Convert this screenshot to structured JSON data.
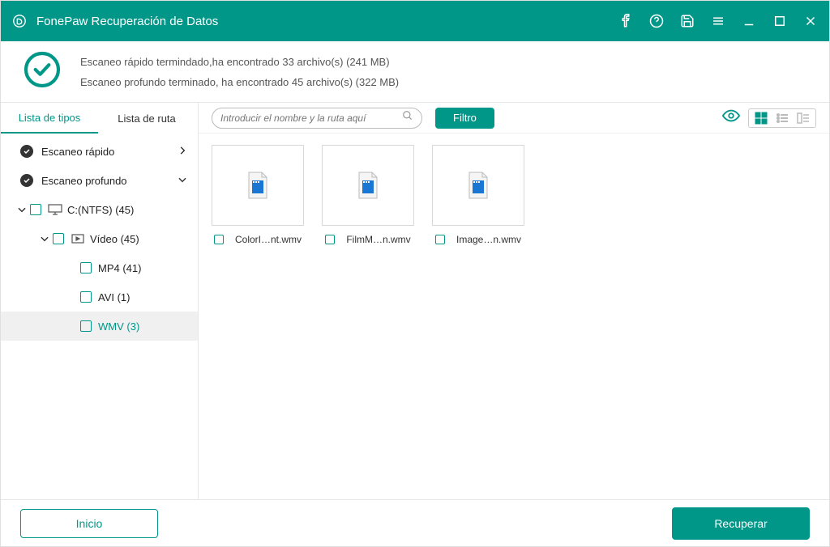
{
  "app": {
    "title": "FonePaw Recuperación de Datos"
  },
  "status": {
    "line1": "Escaneo rápido termindado,ha encontrado 33 archivo(s) (241 MB)",
    "line2": "Escaneo profundo terminado, ha encontrado 45 archivo(s) (322 MB)"
  },
  "sidebar": {
    "tabs": {
      "types": "Lista de tipos",
      "path": "Lista de ruta"
    },
    "quick": "Escaneo rápido",
    "deep": "Escaneo profundo",
    "drive": "C:(NTFS) (45)",
    "video": "Vídeo (45)",
    "mp4": "MP4 (41)",
    "avi": "AVI (1)",
    "wmv": "WMV (3)"
  },
  "toolbar": {
    "search_placeholder": "Introducir el nombre y la ruta aquí",
    "filter": "Filtro"
  },
  "files": [
    {
      "name": "ColorI…nt.wmv"
    },
    {
      "name": "FilmM…n.wmv"
    },
    {
      "name": "Image…n.wmv"
    }
  ],
  "footer": {
    "home": "Inicio",
    "recover": "Recuperar"
  }
}
